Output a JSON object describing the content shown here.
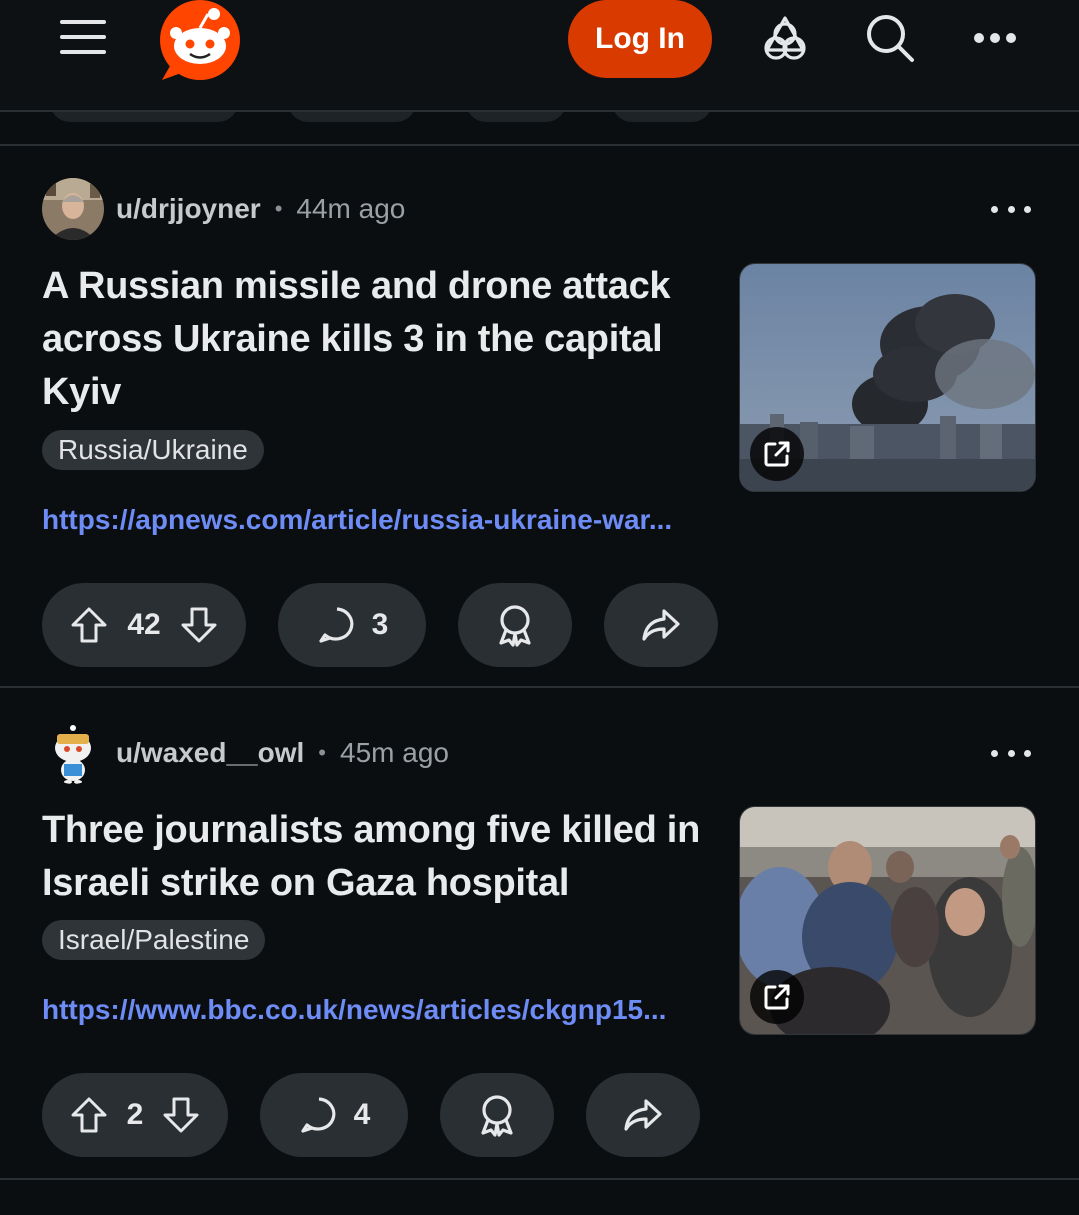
{
  "header": {
    "login_label": "Log In",
    "icons": [
      "hamburger-menu-icon",
      "reddit-logo",
      "popular-icon",
      "search-icon",
      "more-options-icon"
    ]
  },
  "posts": [
    {
      "author": "u/drjjoyner",
      "separator": "•",
      "time": "44m ago",
      "title": "A Russian missile and drone attack across Ukraine kills 3 in the capital Kyiv",
      "flair": "Russia/Ukraine",
      "link": "https://apnews.com/article/russia-ukraine-war...",
      "votes": "42",
      "comments": "3"
    },
    {
      "author": "u/waxed__owl",
      "separator": "•",
      "time": "45m ago",
      "title": "Three journalists among five killed in Israeli strike on Gaza hospital",
      "flair": "Israel/Palestine",
      "link": "https://www.bbc.co.uk/news/articles/ckgnp15...",
      "votes": "2",
      "comments": "4"
    }
  ],
  "colors": {
    "background": "#0b0e10",
    "accent": "#d93a00",
    "link": "#6e8cf5",
    "pill": "#2a2f33"
  }
}
